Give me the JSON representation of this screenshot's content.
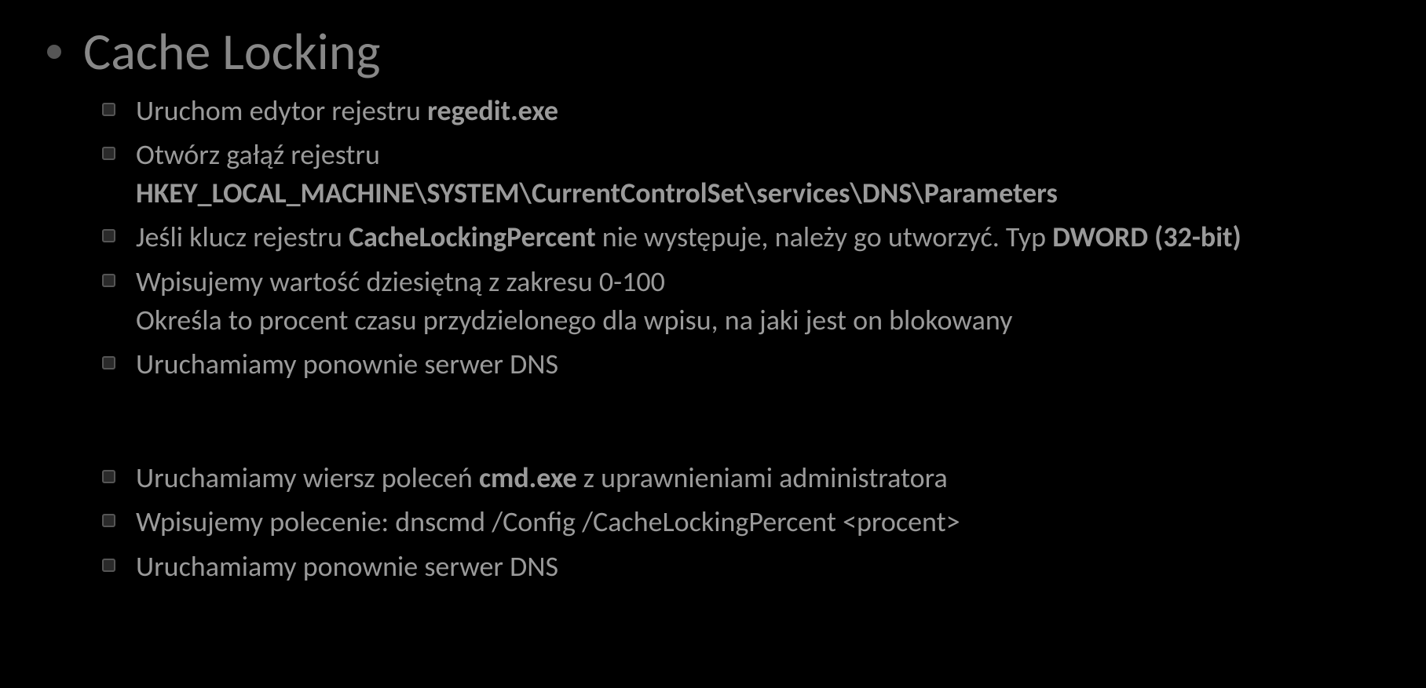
{
  "heading": "Cache Locking",
  "items1": [
    {
      "pre": "Uruchom edytor rejestru ",
      "bold": "regedit.exe",
      "post": ""
    },
    {
      "line1": "Otwórz gałąź rejestru",
      "bold": "HKEY_LOCAL_MACHINE\\SYSTEM\\CurrentControlSet\\services\\DNS\\Parameters"
    },
    {
      "pre": "Jeśli klucz rejestru ",
      "bold": "CacheLockingPercent",
      "mid": " nie występuje, należy go utworzyć. Typ ",
      "bold2": "DWORD (32-bit)"
    },
    {
      "line1": "Wpisujemy wartość dziesiętną z zakresu 0-100",
      "line2": "Określa to procent czasu przydzielonego dla wpisu, na jaki jest on blokowany"
    },
    {
      "text": "Uruchamiamy ponownie serwer DNS"
    }
  ],
  "items2": [
    {
      "pre": "Uruchamiamy wiersz poleceń ",
      "bold": "cmd.exe",
      "post": " z uprawnieniami administratora"
    },
    {
      "text": "Wpisujemy polecenie: dnscmd /Config /CacheLockingPercent <procent>"
    },
    {
      "text": "Uruchamiamy ponownie serwer DNS"
    }
  ]
}
